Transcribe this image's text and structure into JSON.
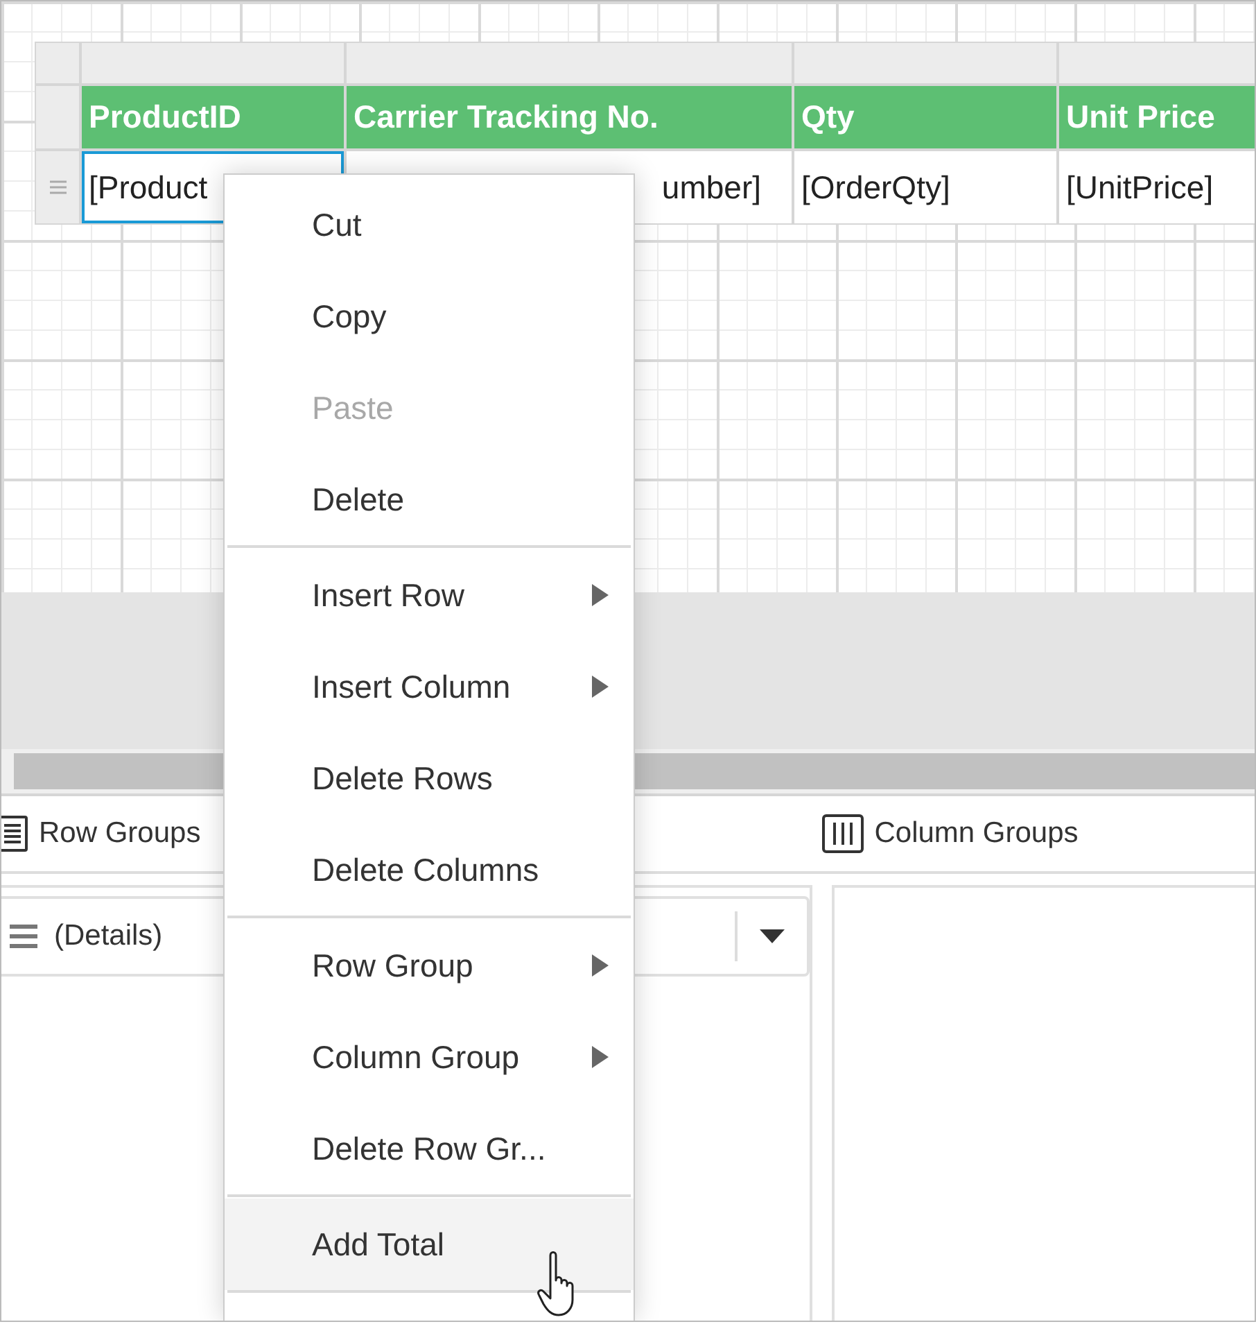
{
  "table": {
    "columns": [
      {
        "label": "ProductID"
      },
      {
        "label": "Carrier Tracking No."
      },
      {
        "label": "Qty"
      },
      {
        "label": "Unit Price"
      }
    ],
    "cells": [
      {
        "text": "[Product",
        "selected": true
      },
      {
        "text": "umber]",
        "selected": false
      },
      {
        "text": "[OrderQty]",
        "selected": false
      },
      {
        "text": "[UnitPrice]",
        "selected": false
      }
    ]
  },
  "context_menu": {
    "items": [
      {
        "kind": "item",
        "label": "Cut",
        "disabled": false,
        "submenu": false,
        "hovered": false
      },
      {
        "kind": "item",
        "label": "Copy",
        "disabled": false,
        "submenu": false,
        "hovered": false
      },
      {
        "kind": "item",
        "label": "Paste",
        "disabled": true,
        "submenu": false,
        "hovered": false
      },
      {
        "kind": "item",
        "label": "Delete",
        "disabled": false,
        "submenu": false,
        "hovered": false
      },
      {
        "kind": "separator"
      },
      {
        "kind": "item",
        "label": "Insert Row",
        "disabled": false,
        "submenu": true,
        "hovered": false
      },
      {
        "kind": "item",
        "label": "Insert Column",
        "disabled": false,
        "submenu": true,
        "hovered": false
      },
      {
        "kind": "item",
        "label": "Delete Rows",
        "disabled": false,
        "submenu": false,
        "hovered": false
      },
      {
        "kind": "item",
        "label": "Delete Columns",
        "disabled": false,
        "submenu": false,
        "hovered": false
      },
      {
        "kind": "separator"
      },
      {
        "kind": "item",
        "label": "Row Group",
        "disabled": false,
        "submenu": true,
        "hovered": false
      },
      {
        "kind": "item",
        "label": "Column Group",
        "disabled": false,
        "submenu": true,
        "hovered": false
      },
      {
        "kind": "item",
        "label": "Delete Row Gr...",
        "disabled": false,
        "submenu": false,
        "hovered": false
      },
      {
        "kind": "separator"
      },
      {
        "kind": "item",
        "label": "Add Total",
        "disabled": false,
        "submenu": false,
        "hovered": true
      },
      {
        "kind": "separator"
      }
    ]
  },
  "grouping_panel": {
    "row_groups_title": "Row Groups",
    "column_groups_title": "Column Groups",
    "row_group": {
      "value": "(Details)"
    }
  }
}
